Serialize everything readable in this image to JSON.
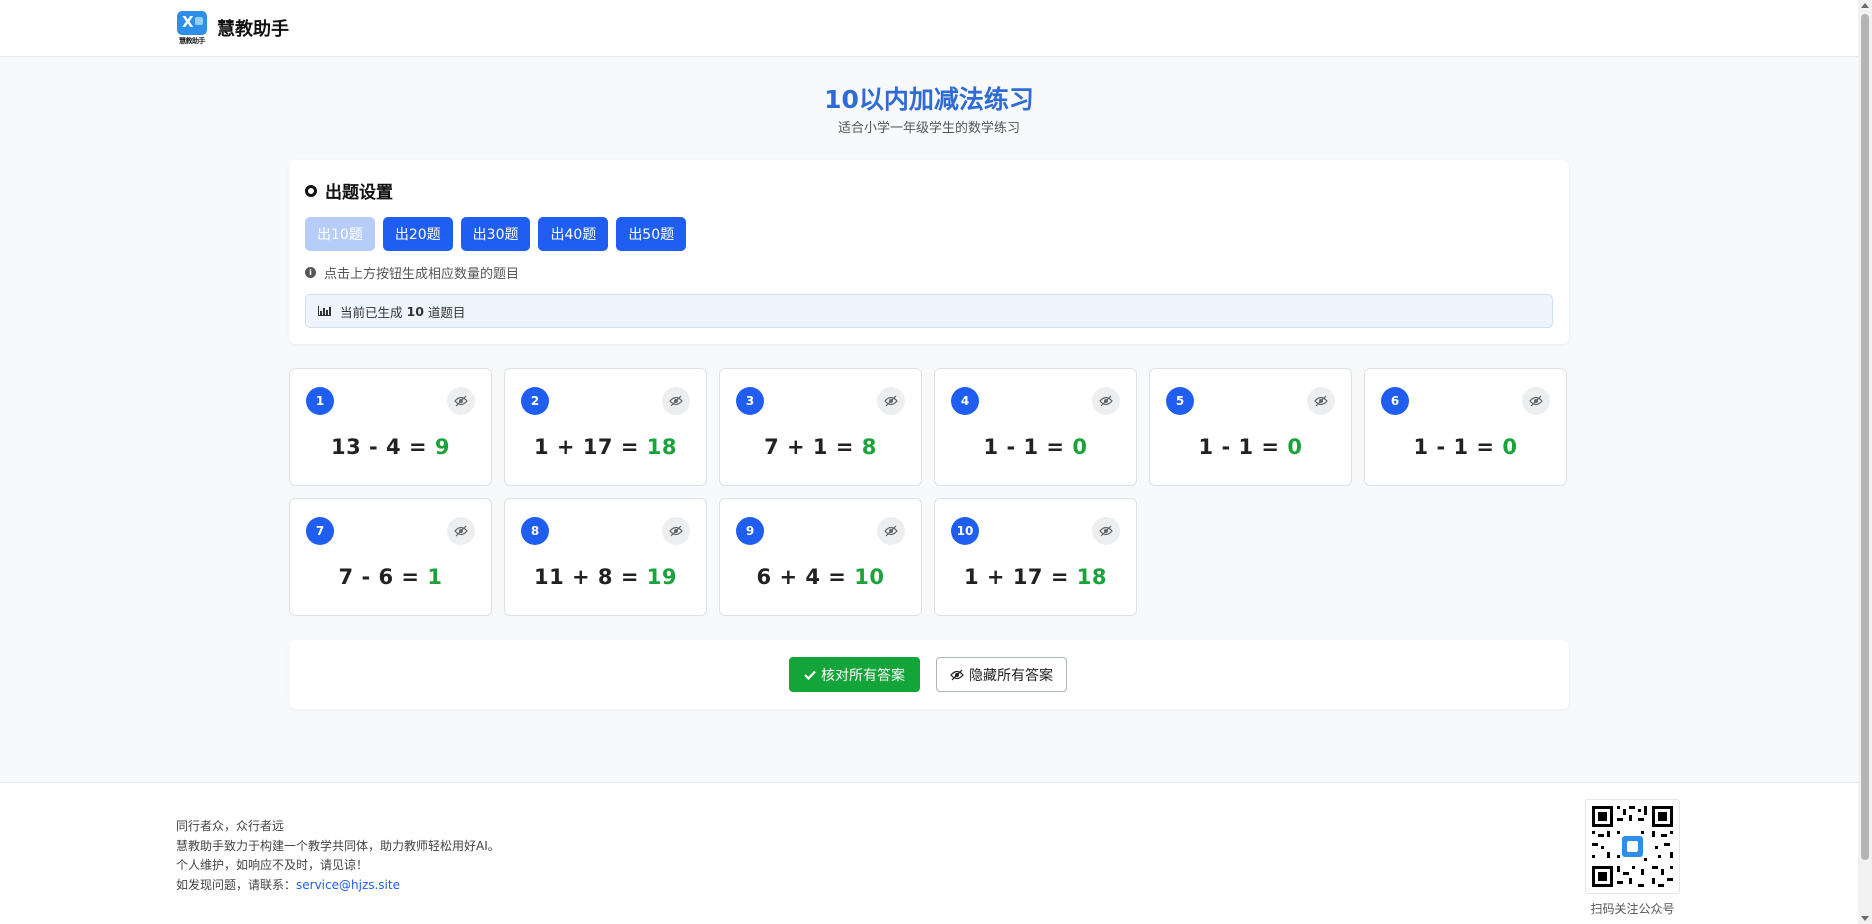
{
  "header": {
    "brand": "慧教助手",
    "logo_caption": "慧教助手",
    "logo_icon": "app-logo-icon"
  },
  "page": {
    "title": "10以内加减法练习",
    "subtitle": "适合小学一年级学生的数学练习"
  },
  "settings": {
    "heading": "出题设置",
    "buttons": [
      {
        "label": "出10题",
        "disabled": true
      },
      {
        "label": "出20题",
        "disabled": false
      },
      {
        "label": "出30题",
        "disabled": false
      },
      {
        "label": "出40题",
        "disabled": false
      },
      {
        "label": "出50题",
        "disabled": false
      }
    ],
    "hint": "点击上方按钮生成相应数量的题目",
    "status_prefix": "当前已生成",
    "status_count": "10",
    "status_suffix": "道题目"
  },
  "questions": [
    {
      "num": "1",
      "expr": "13 - 4 = ",
      "answer": "9"
    },
    {
      "num": "2",
      "expr": "1 + 17 = ",
      "answer": "18"
    },
    {
      "num": "3",
      "expr": "7 + 1 = ",
      "answer": "8"
    },
    {
      "num": "4",
      "expr": "1 - 1 = ",
      "answer": "0"
    },
    {
      "num": "5",
      "expr": "1 - 1 = ",
      "answer": "0"
    },
    {
      "num": "6",
      "expr": "1 - 1 = ",
      "answer": "0"
    },
    {
      "num": "7",
      "expr": "7 - 6 = ",
      "answer": "1"
    },
    {
      "num": "8",
      "expr": "11 + 8 = ",
      "answer": "19"
    },
    {
      "num": "9",
      "expr": "6 + 4 = ",
      "answer": "10"
    },
    {
      "num": "10",
      "expr": "1 + 17 = ",
      "answer": "18"
    }
  ],
  "actions": {
    "check_all": "核对所有答案",
    "hide_all": "隐藏所有答案"
  },
  "footer": {
    "line1": "同行者众，众行者远",
    "line2": "慧教助手致力于构建一个教学共同体，助力教师轻松用好AI。",
    "line3": "个人维护，如响应不及时，请见谅！",
    "line4_prefix": "如发现问题，请联系：",
    "email": "service@hjzs.site",
    "qr_caption": "扫码关注公众号"
  },
  "colors": {
    "primary": "#1f5ef0",
    "answer": "#1aa33a",
    "title": "#2f6bd6",
    "success": "#14a53a"
  }
}
